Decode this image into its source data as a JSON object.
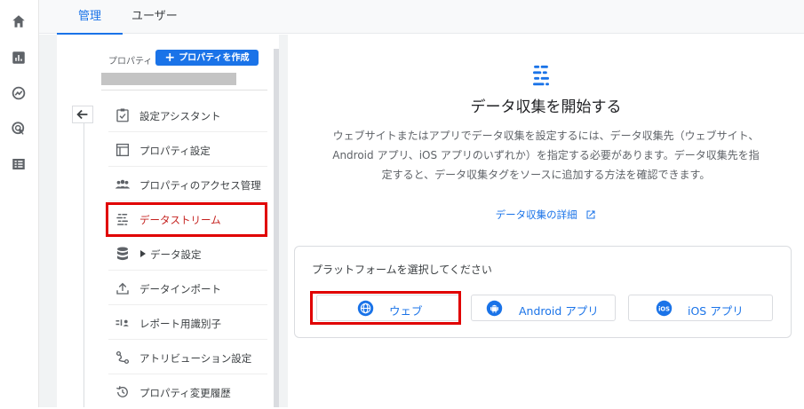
{
  "rail": {
    "icons": [
      "home-icon",
      "reports-icon",
      "explore-icon",
      "advertising-icon",
      "configure-icon"
    ]
  },
  "tabs": [
    {
      "label": "管理",
      "active": true
    },
    {
      "label": "ユーザー",
      "active": false
    }
  ],
  "sidebar": {
    "property_label": "プロパティ",
    "create_button": "プロパティを作成",
    "items": [
      {
        "label": "設定アシスタント",
        "icon": "checklist-icon"
      },
      {
        "label": "プロパティ設定",
        "icon": "property-settings-icon"
      },
      {
        "label": "プロパティのアクセス管理",
        "icon": "people-icon"
      },
      {
        "label": "データストリーム",
        "icon": "data-streams-icon",
        "selected": true
      },
      {
        "label": "データ設定",
        "icon": "database-icon",
        "expandable": true
      },
      {
        "label": "データインポート",
        "icon": "upload-icon"
      },
      {
        "label": "レポート用識別子",
        "icon": "identifier-icon"
      },
      {
        "label": "アトリビューション設定",
        "icon": "attribution-icon"
      },
      {
        "label": "プロパティ変更履歴",
        "icon": "history-icon"
      }
    ]
  },
  "main": {
    "title": "データ収集を開始する",
    "description": "ウェブサイトまたはアプリでデータ収集を設定するには、データ収集先（ウェブサイト、Android アプリ、iOS アプリのいずれか）を指定する必要があります。データ収集先を指定すると、データ収集タグをソースに追加する方法を確認できます。",
    "learn_more": "データ収集の詳細",
    "platform_title": "プラットフォームを選択してください",
    "platforms": [
      {
        "label": "ウェブ",
        "icon": "globe-icon"
      },
      {
        "label": "Android アプリ",
        "icon": "android-icon"
      },
      {
        "label": "iOS アプリ",
        "icon": "ios-icon"
      }
    ]
  },
  "colors": {
    "accent": "#1a73e8",
    "selected_text": "#c5221f",
    "highlight": "#e00000"
  }
}
